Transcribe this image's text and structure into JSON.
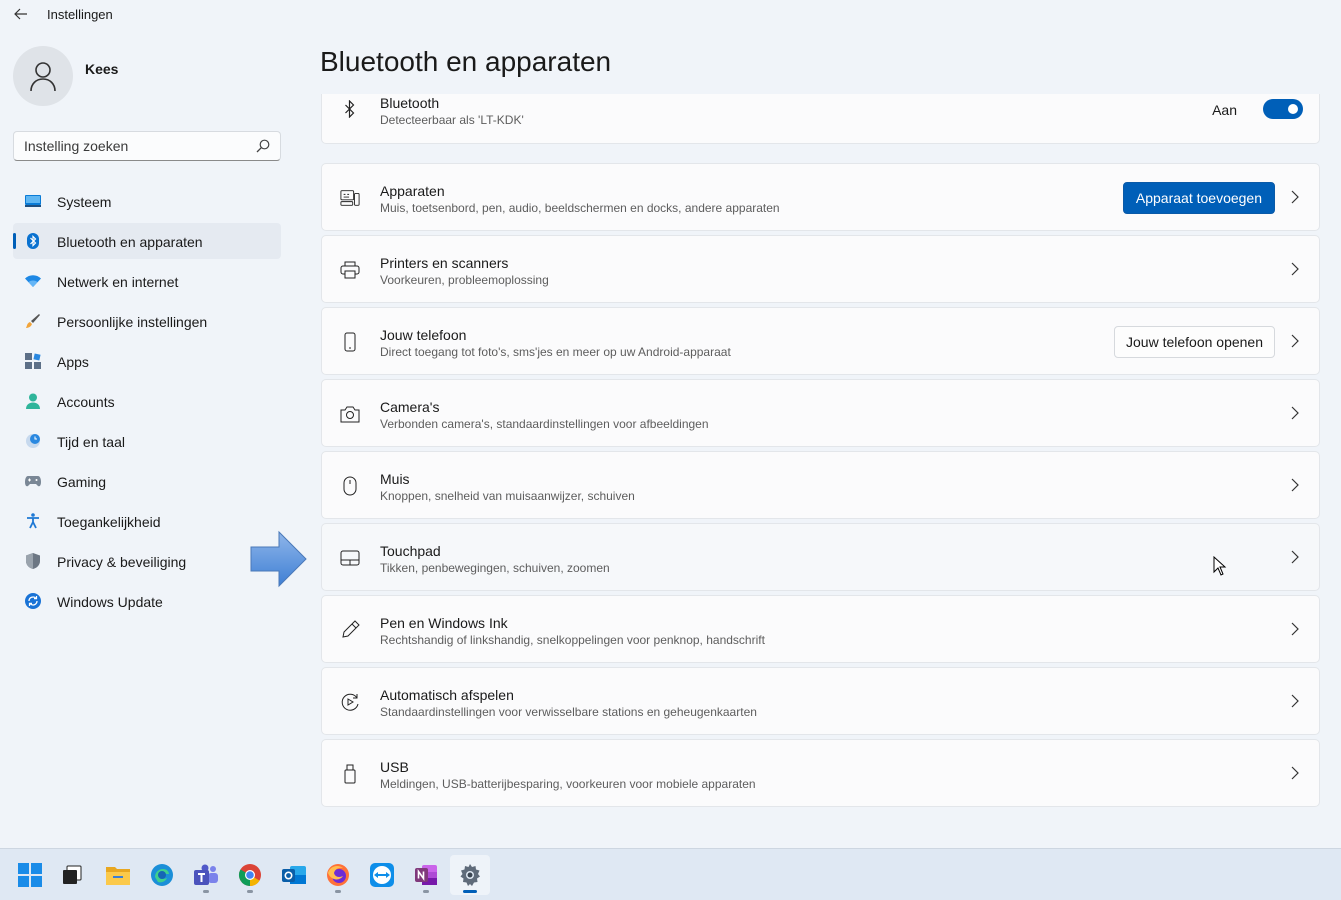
{
  "app": {
    "title": "Instellingen",
    "back_icon": "back-arrow-icon"
  },
  "user": {
    "name": "Kees",
    "avatar_icon": "person-icon"
  },
  "search": {
    "placeholder": "Instelling zoeken",
    "icon": "search-icon"
  },
  "sidebar": {
    "items": [
      {
        "label": "Systeem",
        "icon": "monitor-icon",
        "active": false
      },
      {
        "label": "Bluetooth en apparaten",
        "icon": "bluetooth-icon",
        "active": true
      },
      {
        "label": "Netwerk en internet",
        "icon": "wifi-icon",
        "active": false
      },
      {
        "label": "Persoonlijke instellingen",
        "icon": "brush-icon",
        "active": false
      },
      {
        "label": "Apps",
        "icon": "apps-icon",
        "active": false
      },
      {
        "label": "Accounts",
        "icon": "accounts-icon",
        "active": false
      },
      {
        "label": "Tijd en taal",
        "icon": "clock-globe-icon",
        "active": false
      },
      {
        "label": "Gaming",
        "icon": "gamepad-icon",
        "active": false
      },
      {
        "label": "Toegankelijkheid",
        "icon": "accessibility-icon",
        "active": false
      },
      {
        "label": "Privacy & beveiliging",
        "icon": "shield-icon",
        "active": false
      },
      {
        "label": "Windows Update",
        "icon": "update-icon",
        "active": false
      }
    ]
  },
  "main": {
    "title": "Bluetooth en apparaten",
    "bluetooth": {
      "title": "Bluetooth",
      "subtitle": "Detecteerbaar als 'LT-KDK'",
      "toggle_label": "Aan",
      "toggle_on": true
    },
    "cards": [
      {
        "title": "Apparaten",
        "subtitle": "Muis, toetsenbord, pen, audio, beeldschermen en docks, andere apparaten",
        "icon": "devices-icon",
        "button": "Apparaat toevoegen",
        "button_style": "primary"
      },
      {
        "title": "Printers en scanners",
        "subtitle": "Voorkeuren, probleemoplossing",
        "icon": "printer-icon"
      },
      {
        "title": "Jouw telefoon",
        "subtitle": "Direct toegang tot foto's, sms'jes en meer op uw Android-apparaat",
        "icon": "phone-icon",
        "button": "Jouw telefoon openen",
        "button_style": "secondary"
      },
      {
        "title": "Camera's",
        "subtitle": "Verbonden camera's, standaardinstellingen voor afbeeldingen",
        "icon": "camera-icon"
      },
      {
        "title": "Muis",
        "subtitle": "Knoppen, snelheid van muisaanwijzer, schuiven",
        "icon": "mouse-icon"
      },
      {
        "title": "Touchpad",
        "subtitle": "Tikken, penbewegingen, schuiven, zoomen",
        "icon": "touchpad-icon"
      },
      {
        "title": "Pen en Windows Ink",
        "subtitle": "Rechtshandig of linkshandig, snelkoppelingen voor penknop, handschrift",
        "icon": "pen-icon"
      },
      {
        "title": "Automatisch afspelen",
        "subtitle": "Standaardinstellingen voor verwisselbare stations en geheugenkaarten",
        "icon": "autoplay-icon"
      },
      {
        "title": "USB",
        "subtitle": "Meldingen, USB-batterijbesparing, voorkeuren voor mobiele apparaten",
        "icon": "usb-icon"
      }
    ]
  },
  "taskbar": {
    "items": [
      {
        "name": "start",
        "icon": "windows-start-icon"
      },
      {
        "name": "task-view",
        "icon": "task-view-icon"
      },
      {
        "name": "file-explorer",
        "icon": "folder-icon"
      },
      {
        "name": "edge",
        "icon": "edge-icon"
      },
      {
        "name": "teams",
        "icon": "teams-icon"
      },
      {
        "name": "chrome",
        "icon": "chrome-icon"
      },
      {
        "name": "outlook",
        "icon": "outlook-icon"
      },
      {
        "name": "firefox",
        "icon": "firefox-icon"
      },
      {
        "name": "teamviewer",
        "icon": "teamviewer-icon"
      },
      {
        "name": "onenote",
        "icon": "onenote-icon"
      },
      {
        "name": "settings",
        "icon": "settings-gear-icon"
      }
    ]
  },
  "colors": {
    "accent": "#005fb8",
    "background": "#f0f4f9",
    "card": "#fbfbfc",
    "taskbar": "#dfe8f3"
  }
}
